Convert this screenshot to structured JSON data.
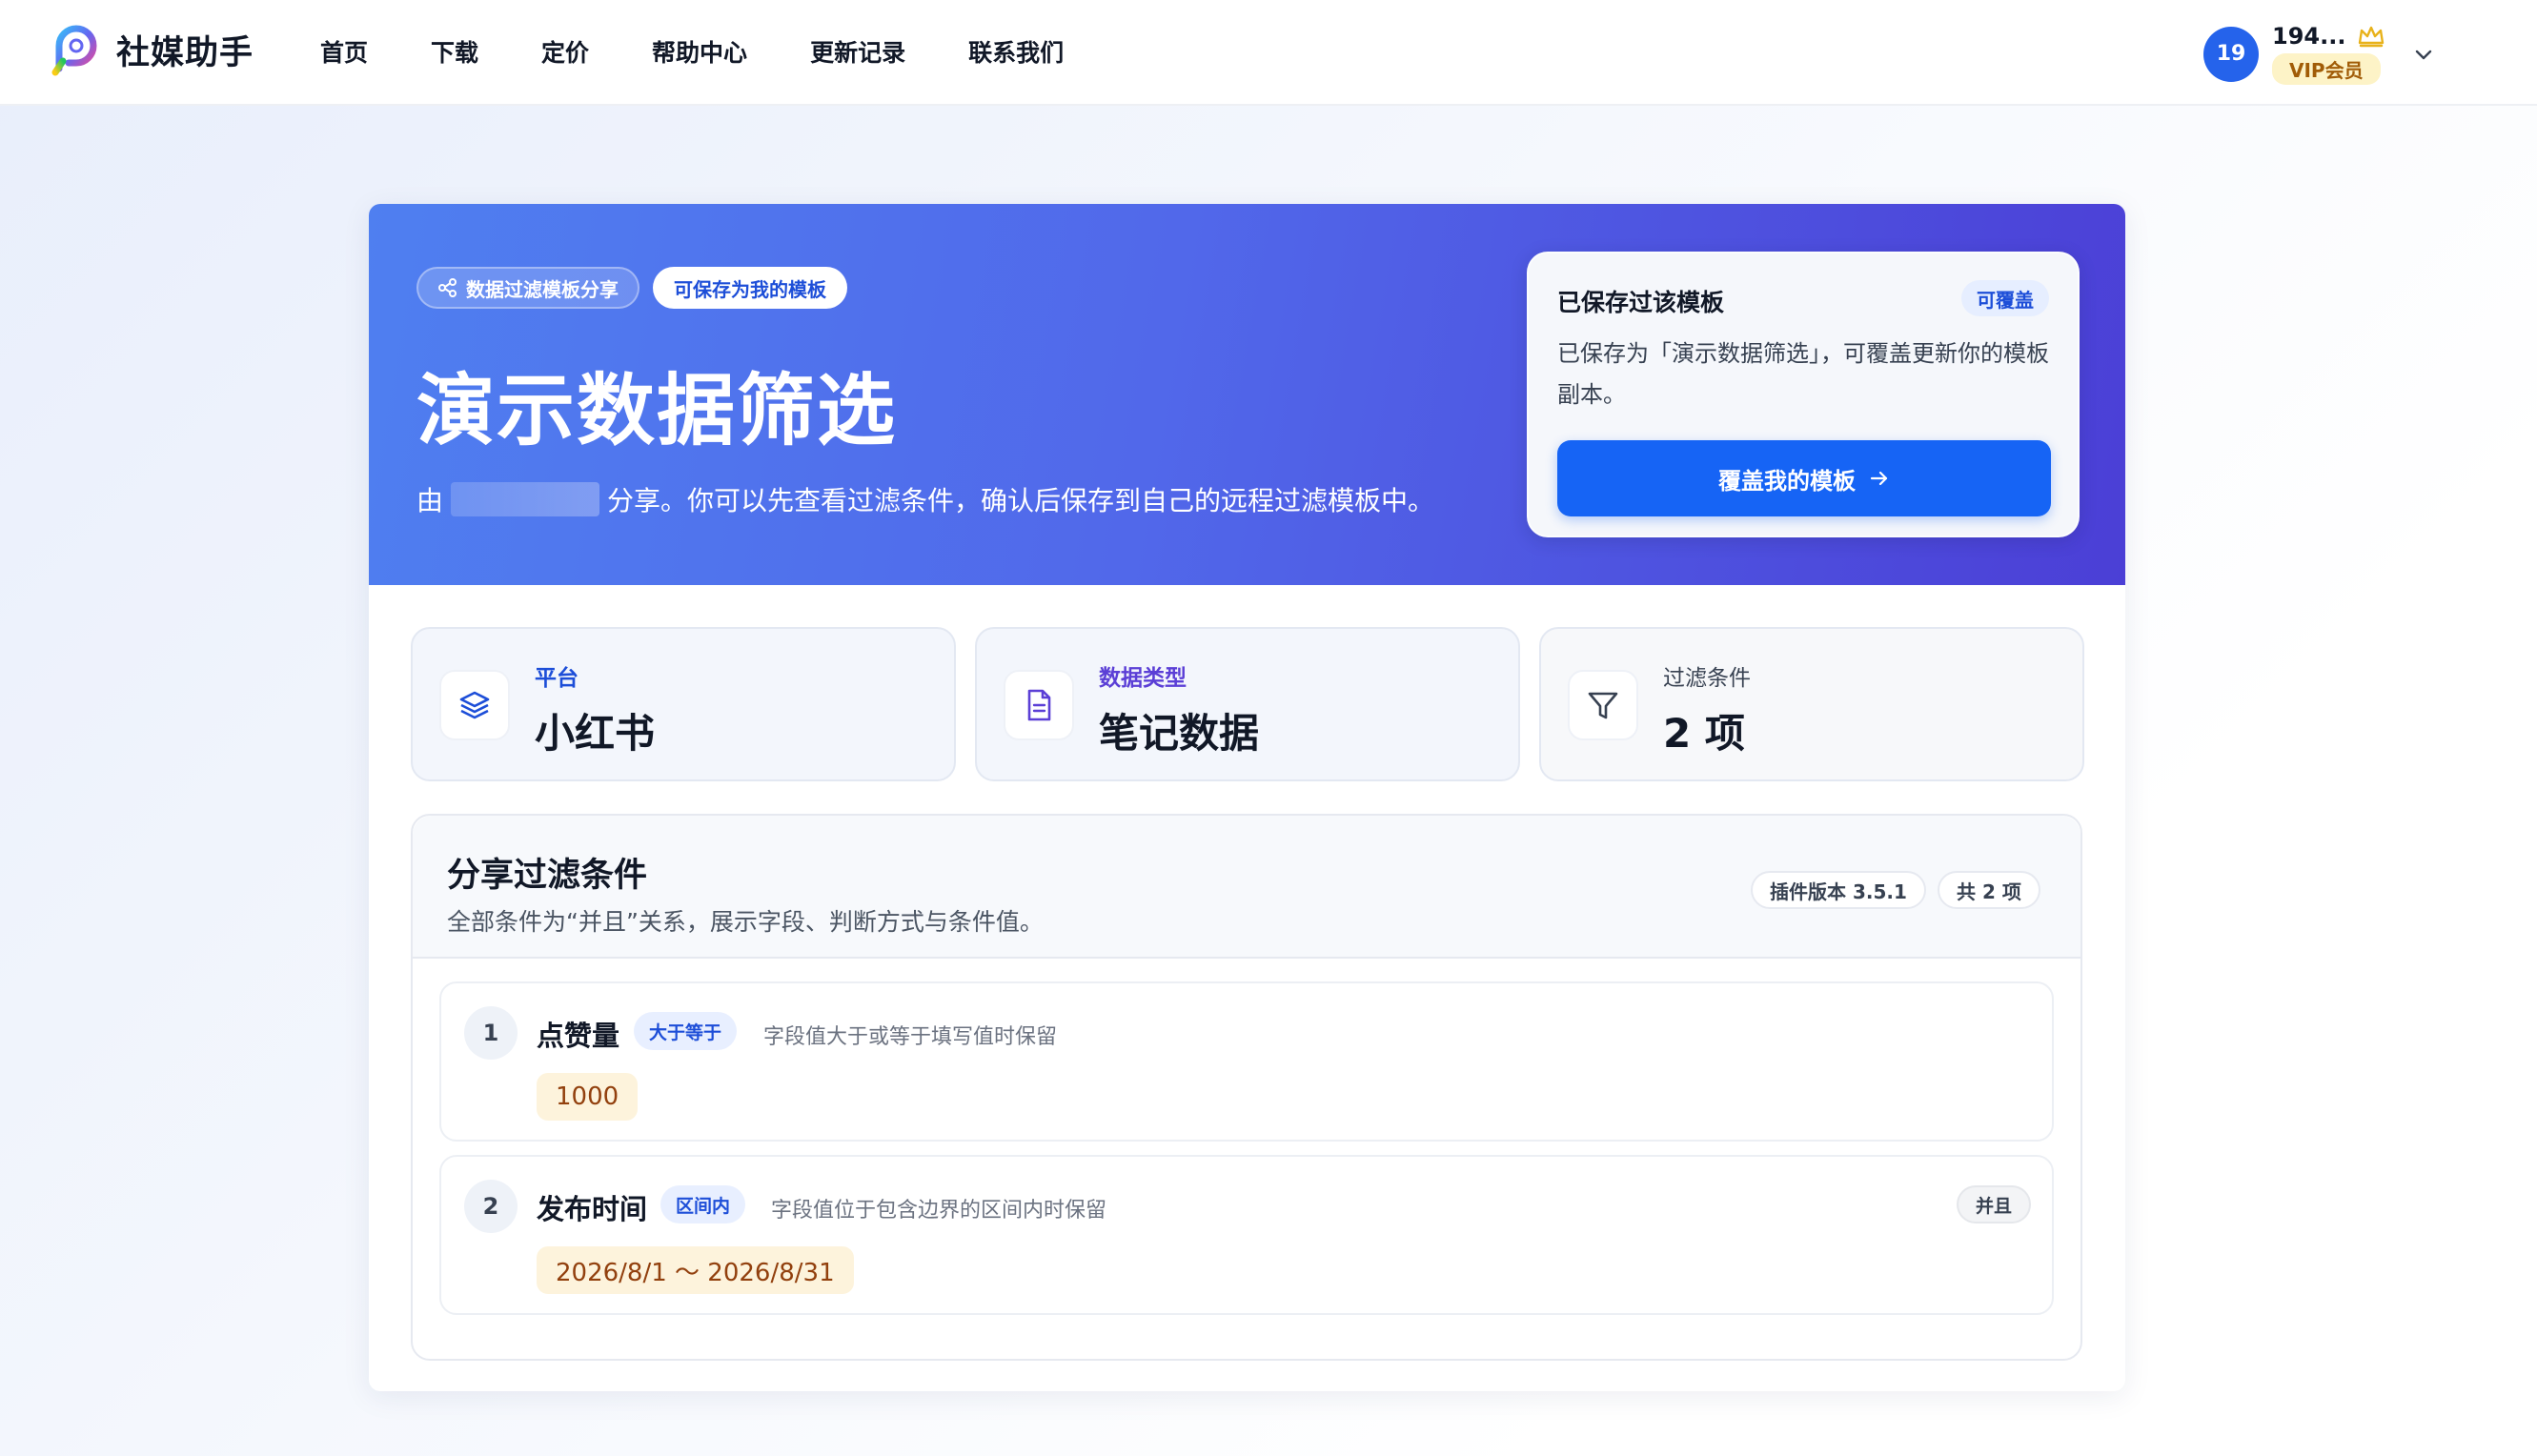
{
  "brand": {
    "name": "社媒助手"
  },
  "nav": [
    {
      "label": "首页"
    },
    {
      "label": "下载"
    },
    {
      "label": "定价"
    },
    {
      "label": "帮助中心"
    },
    {
      "label": "更新记录"
    },
    {
      "label": "联系我们"
    }
  ],
  "user": {
    "avatar_text": "19",
    "name": "194...",
    "vip_label": "VIP会员"
  },
  "hero": {
    "tag_share": "数据过滤模板分享",
    "tag_save": "可保存为我的模板",
    "title": "演示数据筛选",
    "desc_prefix": "由",
    "desc_suffix": "分享。你可以先查看过滤条件，确认后保存到自己的远程过滤模板中。"
  },
  "saved_panel": {
    "title": "已保存过该模板",
    "badge": "可覆盖",
    "desc": "已保存为「演示数据筛选」，可覆盖更新你的模板副本。",
    "button": "覆盖我的模板"
  },
  "stats": [
    {
      "label": "平台",
      "value": "小红书",
      "icon": "layers-icon",
      "color": "#1d4ed8"
    },
    {
      "label": "数据类型",
      "value": "笔记数据",
      "icon": "document-icon",
      "color": "#5b3fd6"
    },
    {
      "label": "过滤条件",
      "value": "2 项",
      "icon": "filter-icon",
      "color": "#374151"
    }
  ],
  "conditions": {
    "title": "分享过滤条件",
    "subtitle": "全部条件为“并且”关系，展示字段、判断方式与条件值。",
    "plugin_version": "插件版本 3.5.1",
    "count": "共 2 项",
    "items": [
      {
        "num": "1",
        "field": "点赞量",
        "op": "大于等于",
        "op_desc": "字段值大于或等于填写值时保留",
        "value": "1000"
      },
      {
        "num": "2",
        "field": "发布时间",
        "op": "区间内",
        "op_desc": "字段值位于包含边界的区间内时保留",
        "value": "2026/8/1 ～ 2026/8/31",
        "join": "并且"
      }
    ]
  },
  "colors": {
    "primary": "#1664f5",
    "hero_start": "#4f7ff0",
    "hero_end": "#4b3fd6",
    "vip_gold": "#e8b21a"
  }
}
